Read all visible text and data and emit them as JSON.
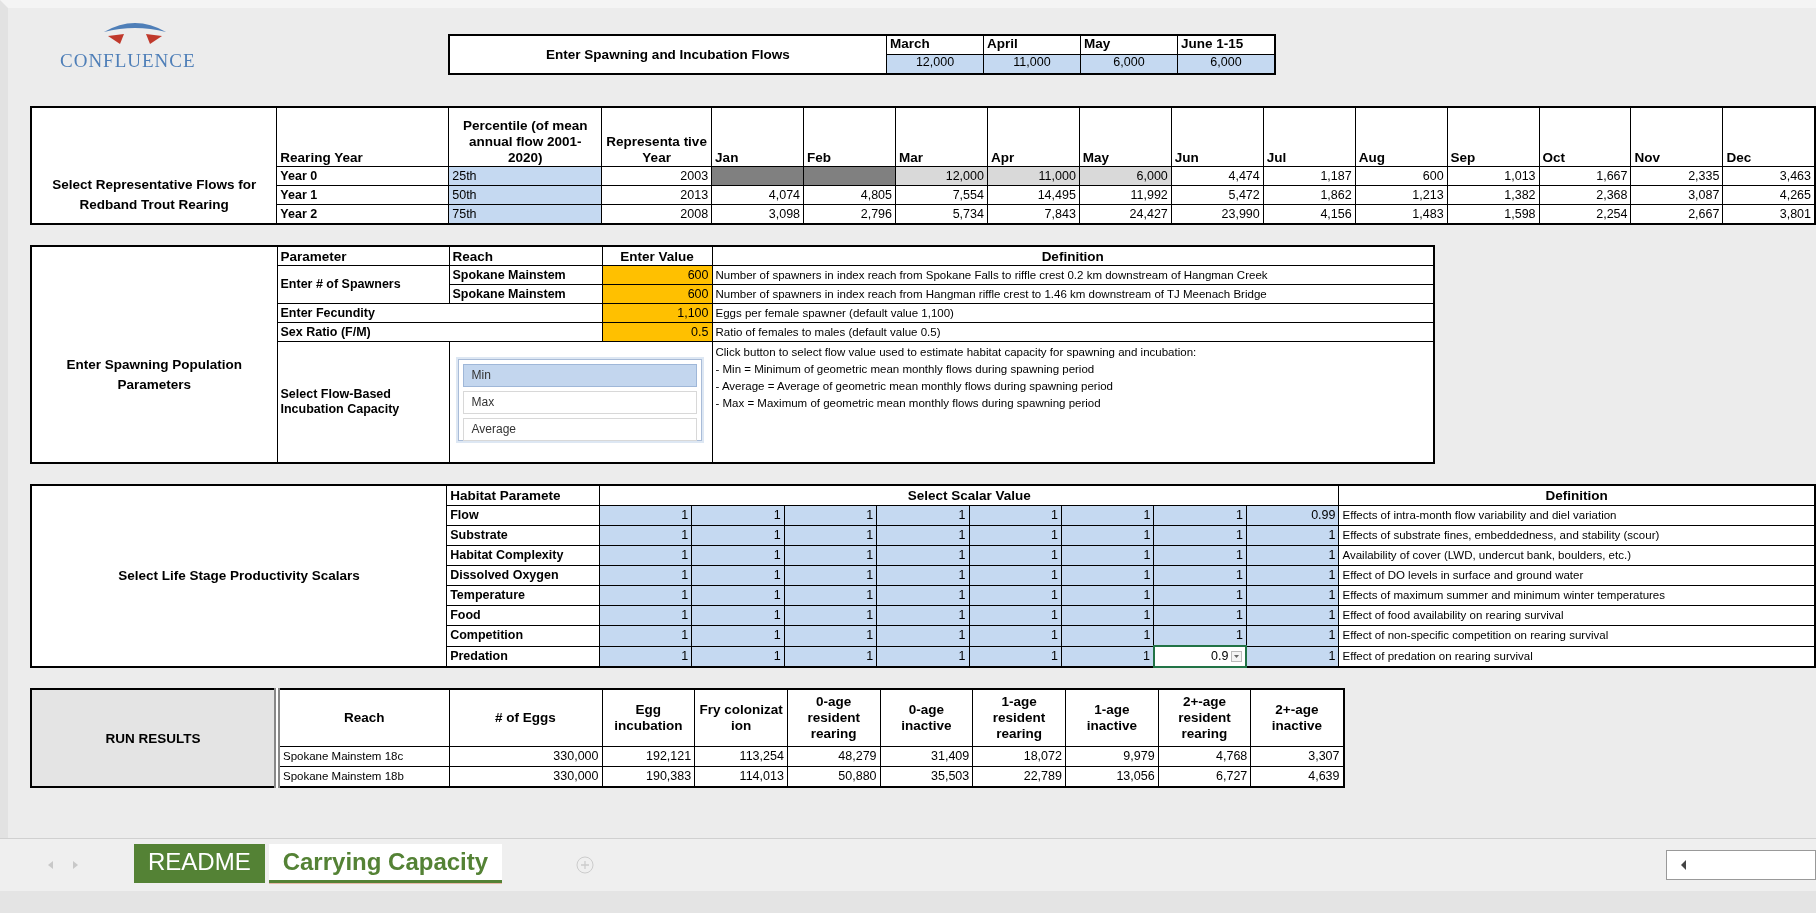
{
  "logo": {
    "text": "CONFLUENCE"
  },
  "spawning_flows": {
    "title": "Enter Spawning and Incubation Flows",
    "months": [
      {
        "label": "March",
        "value": "12,000"
      },
      {
        "label": "April",
        "value": "11,000"
      },
      {
        "label": "May",
        "value": "6,000"
      },
      {
        "label": "June 1-15",
        "value": "6,000"
      }
    ]
  },
  "rearing": {
    "title": "Select Representative Flows for Redband Trout Rearing",
    "columns": [
      "Rearing Year",
      "Percentile (of mean annual flow 2001-2020)",
      "Representa tive Year",
      "Jan",
      "Feb",
      "Mar",
      "Apr",
      "May",
      "Jun",
      "Jul",
      "Aug",
      "Sep",
      "Oct",
      "Nov",
      "Dec"
    ],
    "rows": [
      {
        "year": "Year 0",
        "percentile": "25th",
        "rep_year": "2003",
        "months": [
          {
            "kind": "blocked"
          },
          {
            "kind": "blocked"
          },
          {
            "kind": "linked",
            "value": "12,000"
          },
          {
            "kind": "linked",
            "value": "11,000"
          },
          {
            "kind": "linked",
            "value": "6,000"
          },
          {
            "kind": "plain",
            "value": "4,474"
          },
          {
            "kind": "plain",
            "value": "1,187"
          },
          {
            "kind": "plain",
            "value": "600"
          },
          {
            "kind": "plain",
            "value": "1,013"
          },
          {
            "kind": "plain",
            "value": "1,667"
          },
          {
            "kind": "plain",
            "value": "2,335"
          },
          {
            "kind": "plain",
            "value": "3,463"
          }
        ]
      },
      {
        "year": "Year 1",
        "percentile": "50th",
        "rep_year": "2013",
        "months": [
          {
            "kind": "plain",
            "value": "4,074"
          },
          {
            "kind": "plain",
            "value": "4,805"
          },
          {
            "kind": "plain",
            "value": "7,554"
          },
          {
            "kind": "plain",
            "value": "14,495"
          },
          {
            "kind": "plain",
            "value": "11,992"
          },
          {
            "kind": "plain",
            "value": "5,472"
          },
          {
            "kind": "plain",
            "value": "1,862"
          },
          {
            "kind": "plain",
            "value": "1,213"
          },
          {
            "kind": "plain",
            "value": "1,382"
          },
          {
            "kind": "plain",
            "value": "2,368"
          },
          {
            "kind": "plain",
            "value": "3,087"
          },
          {
            "kind": "plain",
            "value": "4,265"
          }
        ]
      },
      {
        "year": "Year 2",
        "percentile": "75th",
        "rep_year": "2008",
        "months": [
          {
            "kind": "plain",
            "value": "3,098"
          },
          {
            "kind": "plain",
            "value": "2,796"
          },
          {
            "kind": "plain",
            "value": "5,734"
          },
          {
            "kind": "plain",
            "value": "7,843"
          },
          {
            "kind": "plain",
            "value": "24,427"
          },
          {
            "kind": "plain",
            "value": "23,990"
          },
          {
            "kind": "plain",
            "value": "4,156"
          },
          {
            "kind": "plain",
            "value": "1,483"
          },
          {
            "kind": "plain",
            "value": "1,598"
          },
          {
            "kind": "plain",
            "value": "2,254"
          },
          {
            "kind": "plain",
            "value": "2,667"
          },
          {
            "kind": "plain",
            "value": "3,801"
          }
        ]
      }
    ]
  },
  "spawning": {
    "title": "Enter Spawning Population Parameters",
    "columns": [
      "Parameter",
      "Reach",
      "Enter Value",
      "Definition"
    ],
    "spawners": {
      "label": "Enter # of Spawners",
      "reaches": [
        {
          "reach": "Spokane Mainstem",
          "value": "600",
          "definition": "Number of spawners in index reach from Spokane Falls to riffle crest 0.2 km downstream of Hangman Creek"
        },
        {
          "reach": "Spokane Mainstem",
          "value": "600",
          "definition": "Number of spawners in index reach from Hangman riffle crest to 1.46 km downstream of TJ Meenach Bridge"
        }
      ]
    },
    "fecundity": {
      "label": "Enter Fecundity",
      "value": "1,100",
      "definition": "Eggs per female spawner (default value 1,100)"
    },
    "sex_ratio": {
      "label": "Sex Ratio (F/M)",
      "value": "0.5",
      "definition": "Ratio of females to males (default value 0.5)"
    },
    "incubation": {
      "label": "Select Flow-Based Incubation Capacity",
      "options": [
        {
          "label": "Min",
          "selected": true
        },
        {
          "label": "Max",
          "selected": false
        },
        {
          "label": "Average",
          "selected": false
        }
      ],
      "definition_lines": [
        "Click button to select flow value used to estimate habitat capacity for spawning and incubation:",
        " - Min = Minimum of geometric mean monthly flows during spawning period",
        " - Average = Average of geometric mean monthly flows during spawning period",
        " - Max = Maximum of geometric mean monthly flows during spawning period"
      ]
    }
  },
  "scalars": {
    "title": "Select Life Stage Productivity Scalars",
    "parameter_header": "Habitat Paramete",
    "values_header": "Select Scalar Value",
    "definition_header": "Definition",
    "rows": [
      {
        "parameter": "Flow",
        "values": [
          {
            "value": "1",
            "selected": false
          },
          {
            "value": "1",
            "selected": false
          },
          {
            "value": "1",
            "selected": false
          },
          {
            "value": "1",
            "selected": false
          },
          {
            "value": "1",
            "selected": false
          },
          {
            "value": "1",
            "selected": false
          },
          {
            "value": "1",
            "selected": false
          },
          {
            "value": "0.99",
            "selected": false
          }
        ],
        "definition": "Effects of intra-month flow variability and diel variation"
      },
      {
        "parameter": "Substrate",
        "values": [
          {
            "value": "1",
            "selected": false
          },
          {
            "value": "1",
            "selected": false
          },
          {
            "value": "1",
            "selected": false
          },
          {
            "value": "1",
            "selected": false
          },
          {
            "value": "1",
            "selected": false
          },
          {
            "value": "1",
            "selected": false
          },
          {
            "value": "1",
            "selected": false
          },
          {
            "value": "1",
            "selected": false
          }
        ],
        "definition": "Effects of substrate fines, embeddedness, and stability (scour)"
      },
      {
        "parameter": "Habitat Complexity",
        "values": [
          {
            "value": "1",
            "selected": false
          },
          {
            "value": "1",
            "selected": false
          },
          {
            "value": "1",
            "selected": false
          },
          {
            "value": "1",
            "selected": false
          },
          {
            "value": "1",
            "selected": false
          },
          {
            "value": "1",
            "selected": false
          },
          {
            "value": "1",
            "selected": false
          },
          {
            "value": "1",
            "selected": false
          }
        ],
        "definition": "Availability of cover (LWD, undercut bank, boulders, etc.)"
      },
      {
        "parameter": "Dissolved Oxygen",
        "values": [
          {
            "value": "1",
            "selected": false
          },
          {
            "value": "1",
            "selected": false
          },
          {
            "value": "1",
            "selected": false
          },
          {
            "value": "1",
            "selected": false
          },
          {
            "value": "1",
            "selected": false
          },
          {
            "value": "1",
            "selected": false
          },
          {
            "value": "1",
            "selected": false
          },
          {
            "value": "1",
            "selected": false
          }
        ],
        "definition": "Effect of DO levels in surface and ground water"
      },
      {
        "parameter": "Temperature",
        "values": [
          {
            "value": "1",
            "selected": false
          },
          {
            "value": "1",
            "selected": false
          },
          {
            "value": "1",
            "selected": false
          },
          {
            "value": "1",
            "selected": false
          },
          {
            "value": "1",
            "selected": false
          },
          {
            "value": "1",
            "selected": false
          },
          {
            "value": "1",
            "selected": false
          },
          {
            "value": "1",
            "selected": false
          }
        ],
        "definition": "Effects of maximum summer and minimum winter temperatures"
      },
      {
        "parameter": "Food",
        "values": [
          {
            "value": "1",
            "selected": false
          },
          {
            "value": "1",
            "selected": false
          },
          {
            "value": "1",
            "selected": false
          },
          {
            "value": "1",
            "selected": false
          },
          {
            "value": "1",
            "selected": false
          },
          {
            "value": "1",
            "selected": false
          },
          {
            "value": "1",
            "selected": false
          },
          {
            "value": "1",
            "selected": false
          }
        ],
        "definition": "Effect of food availability on rearing survival"
      },
      {
        "parameter": "Competition",
        "values": [
          {
            "value": "1",
            "selected": false
          },
          {
            "value": "1",
            "selected": false
          },
          {
            "value": "1",
            "selected": false
          },
          {
            "value": "1",
            "selected": false
          },
          {
            "value": "1",
            "selected": false
          },
          {
            "value": "1",
            "selected": false
          },
          {
            "value": "1",
            "selected": false
          },
          {
            "value": "1",
            "selected": false
          }
        ],
        "definition": "Effect of non-specific competition on rearing survival"
      },
      {
        "parameter": "Predation",
        "values": [
          {
            "value": "1",
            "selected": false
          },
          {
            "value": "1",
            "selected": false
          },
          {
            "value": "1",
            "selected": false
          },
          {
            "value": "1",
            "selected": false
          },
          {
            "value": "1",
            "selected": false
          },
          {
            "value": "1",
            "selected": false
          },
          {
            "value": "0.9",
            "selected": true
          },
          {
            "value": "1",
            "selected": false
          }
        ],
        "definition": "Effect of predation on rearing survival"
      }
    ]
  },
  "results": {
    "button": "RUN RESULTS",
    "columns": [
      "Reach",
      "# of Eggs",
      "Egg incubation",
      "Fry colonizat ion",
      "0-age resident rearing",
      "0-age inactive",
      "1-age resident rearing",
      "1-age inactive",
      "2+-age resident rearing",
      "2+-age inactive"
    ],
    "rows": [
      [
        "Spokane Mainstem 18c",
        "330,000",
        "192,121",
        "113,254",
        "48,279",
        "31,409",
        "18,072",
        "9,979",
        "4,768",
        "3,307"
      ],
      [
        "Spokane Mainstem 18b",
        "330,000",
        "190,383",
        "114,013",
        "50,880",
        "35,503",
        "22,789",
        "13,056",
        "6,727",
        "4,639"
      ]
    ]
  },
  "sheet_tabs": [
    {
      "label": "README",
      "selected": false,
      "color": "#548235"
    },
    {
      "label": "Carrying Capacity",
      "selected": true,
      "color": "#548235"
    }
  ]
}
